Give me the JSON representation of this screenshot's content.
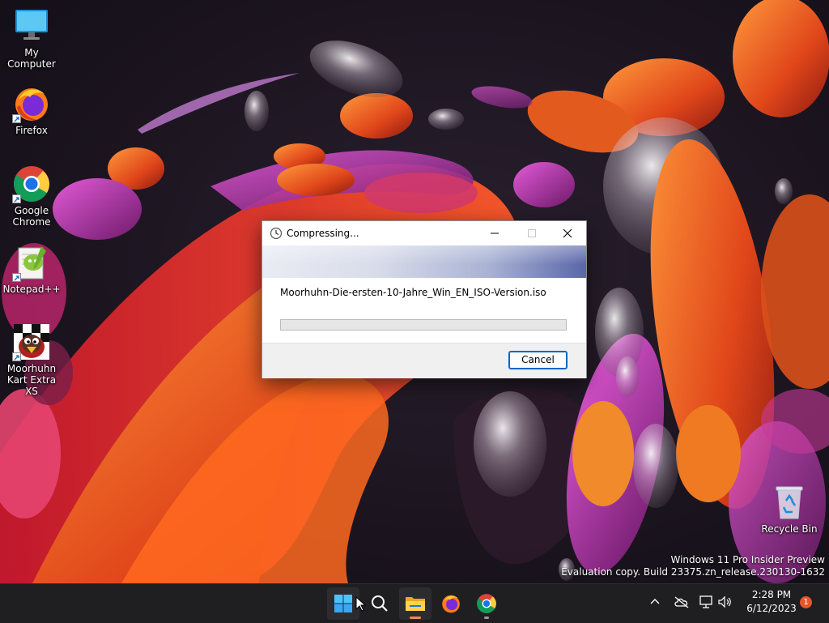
{
  "desktop": {
    "icons": [
      {
        "label_lines": [
          "My Computer"
        ],
        "icon": "computer-icon"
      },
      {
        "label_lines": [
          "Firefox"
        ],
        "icon": "firefox-icon"
      },
      {
        "label_lines": [
          "Google",
          "Chrome"
        ],
        "icon": "chrome-icon"
      },
      {
        "label_lines": [
          "Notepad++"
        ],
        "icon": "notepad-plus-plus-icon"
      },
      {
        "label_lines": [
          "Moorhuhn",
          "Kart Extra XS"
        ],
        "icon": "moorhuhn-icon"
      },
      {
        "label_lines": [
          "Recycle Bin"
        ],
        "icon": "recycle-bin-icon"
      }
    ],
    "watermark": {
      "line1": "Windows 11 Pro Insider Preview",
      "line2": "Evaluation copy. Build 23375.zn_release.230130-1632"
    }
  },
  "dialog": {
    "title": "Compressing...",
    "filename": "Moorhuhn-Die-ersten-10-Jahre_Win_EN_ISO-Version.iso",
    "progress": 0,
    "cancel_label": "Cancel"
  },
  "taskbar": {
    "apps": [
      "start-icon",
      "search-icon",
      "file-explorer-icon",
      "firefox-icon",
      "chrome-icon"
    ],
    "clock": {
      "time": "2:28 PM",
      "date": "6/12/2023"
    },
    "notification_count": "1"
  },
  "colors": {
    "accent": "#0067c0",
    "taskbar": "#1f1f22",
    "wallpaper_orange": "#e8621e",
    "wallpaper_magenta": "#b23aa6"
  }
}
